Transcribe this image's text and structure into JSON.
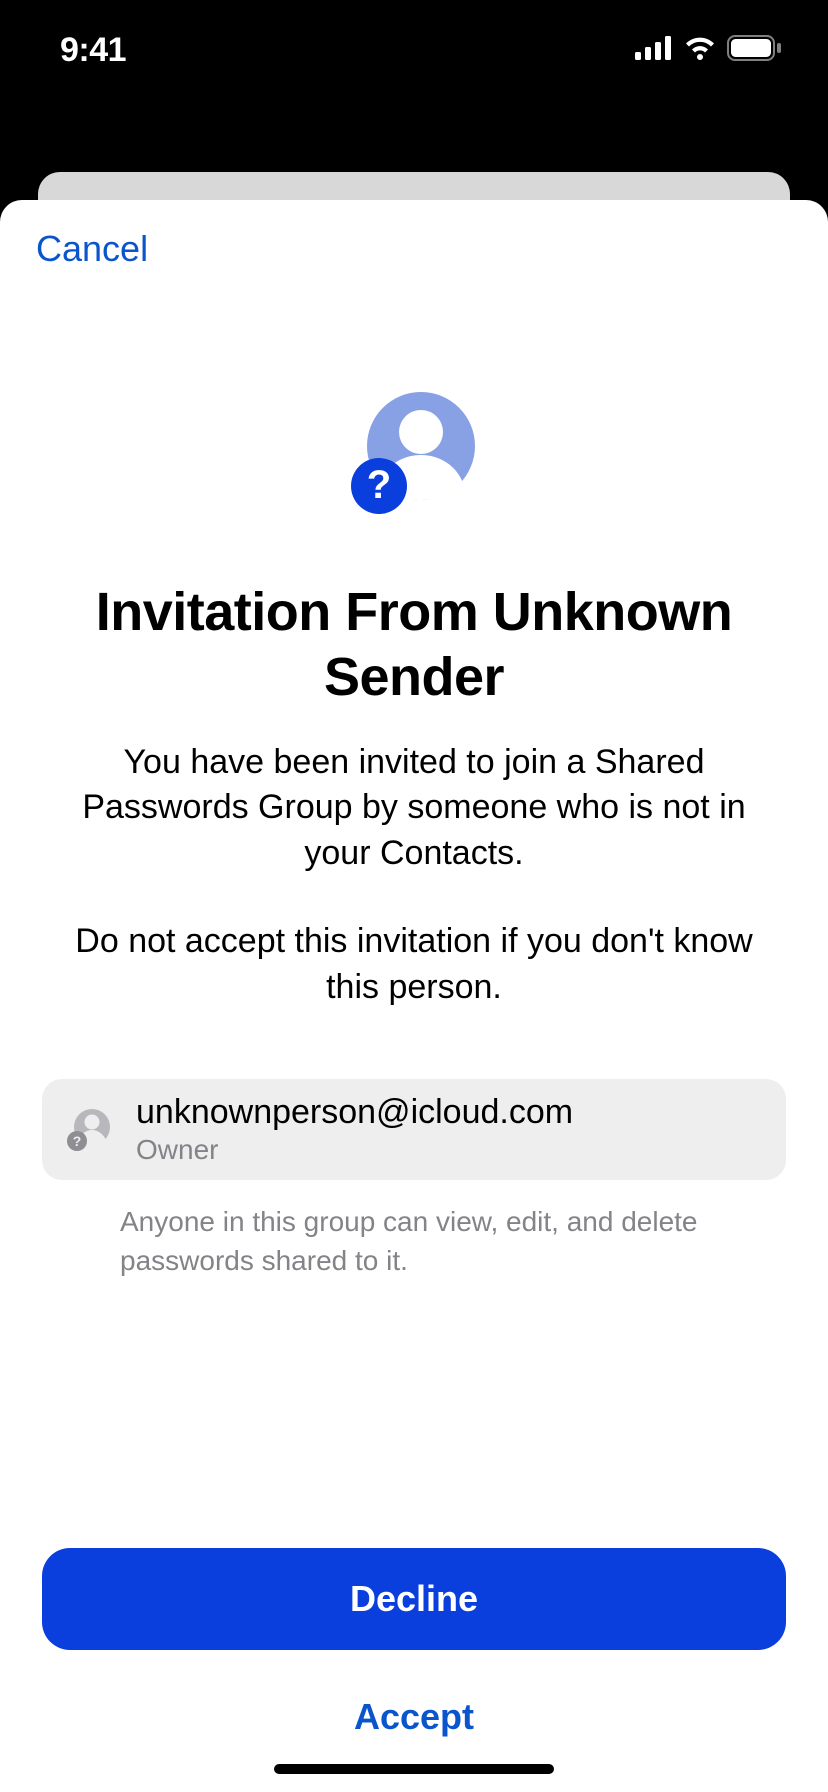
{
  "statusBar": {
    "time": "9:41"
  },
  "nav": {
    "cancel": "Cancel"
  },
  "hero": {
    "title": "Invitation From Unknown Sender",
    "body": "You have been invited to join a Shared Passwords Group by someone who is not in your Contacts.",
    "warning": "Do not accept this invitation if you don't know this person."
  },
  "sender": {
    "email": "unknownperson@icloud.com",
    "role": "Owner"
  },
  "footnote": "Anyone in this group can view, edit, and delete passwords shared to it.",
  "actions": {
    "decline": "Decline",
    "accept": "Accept"
  }
}
